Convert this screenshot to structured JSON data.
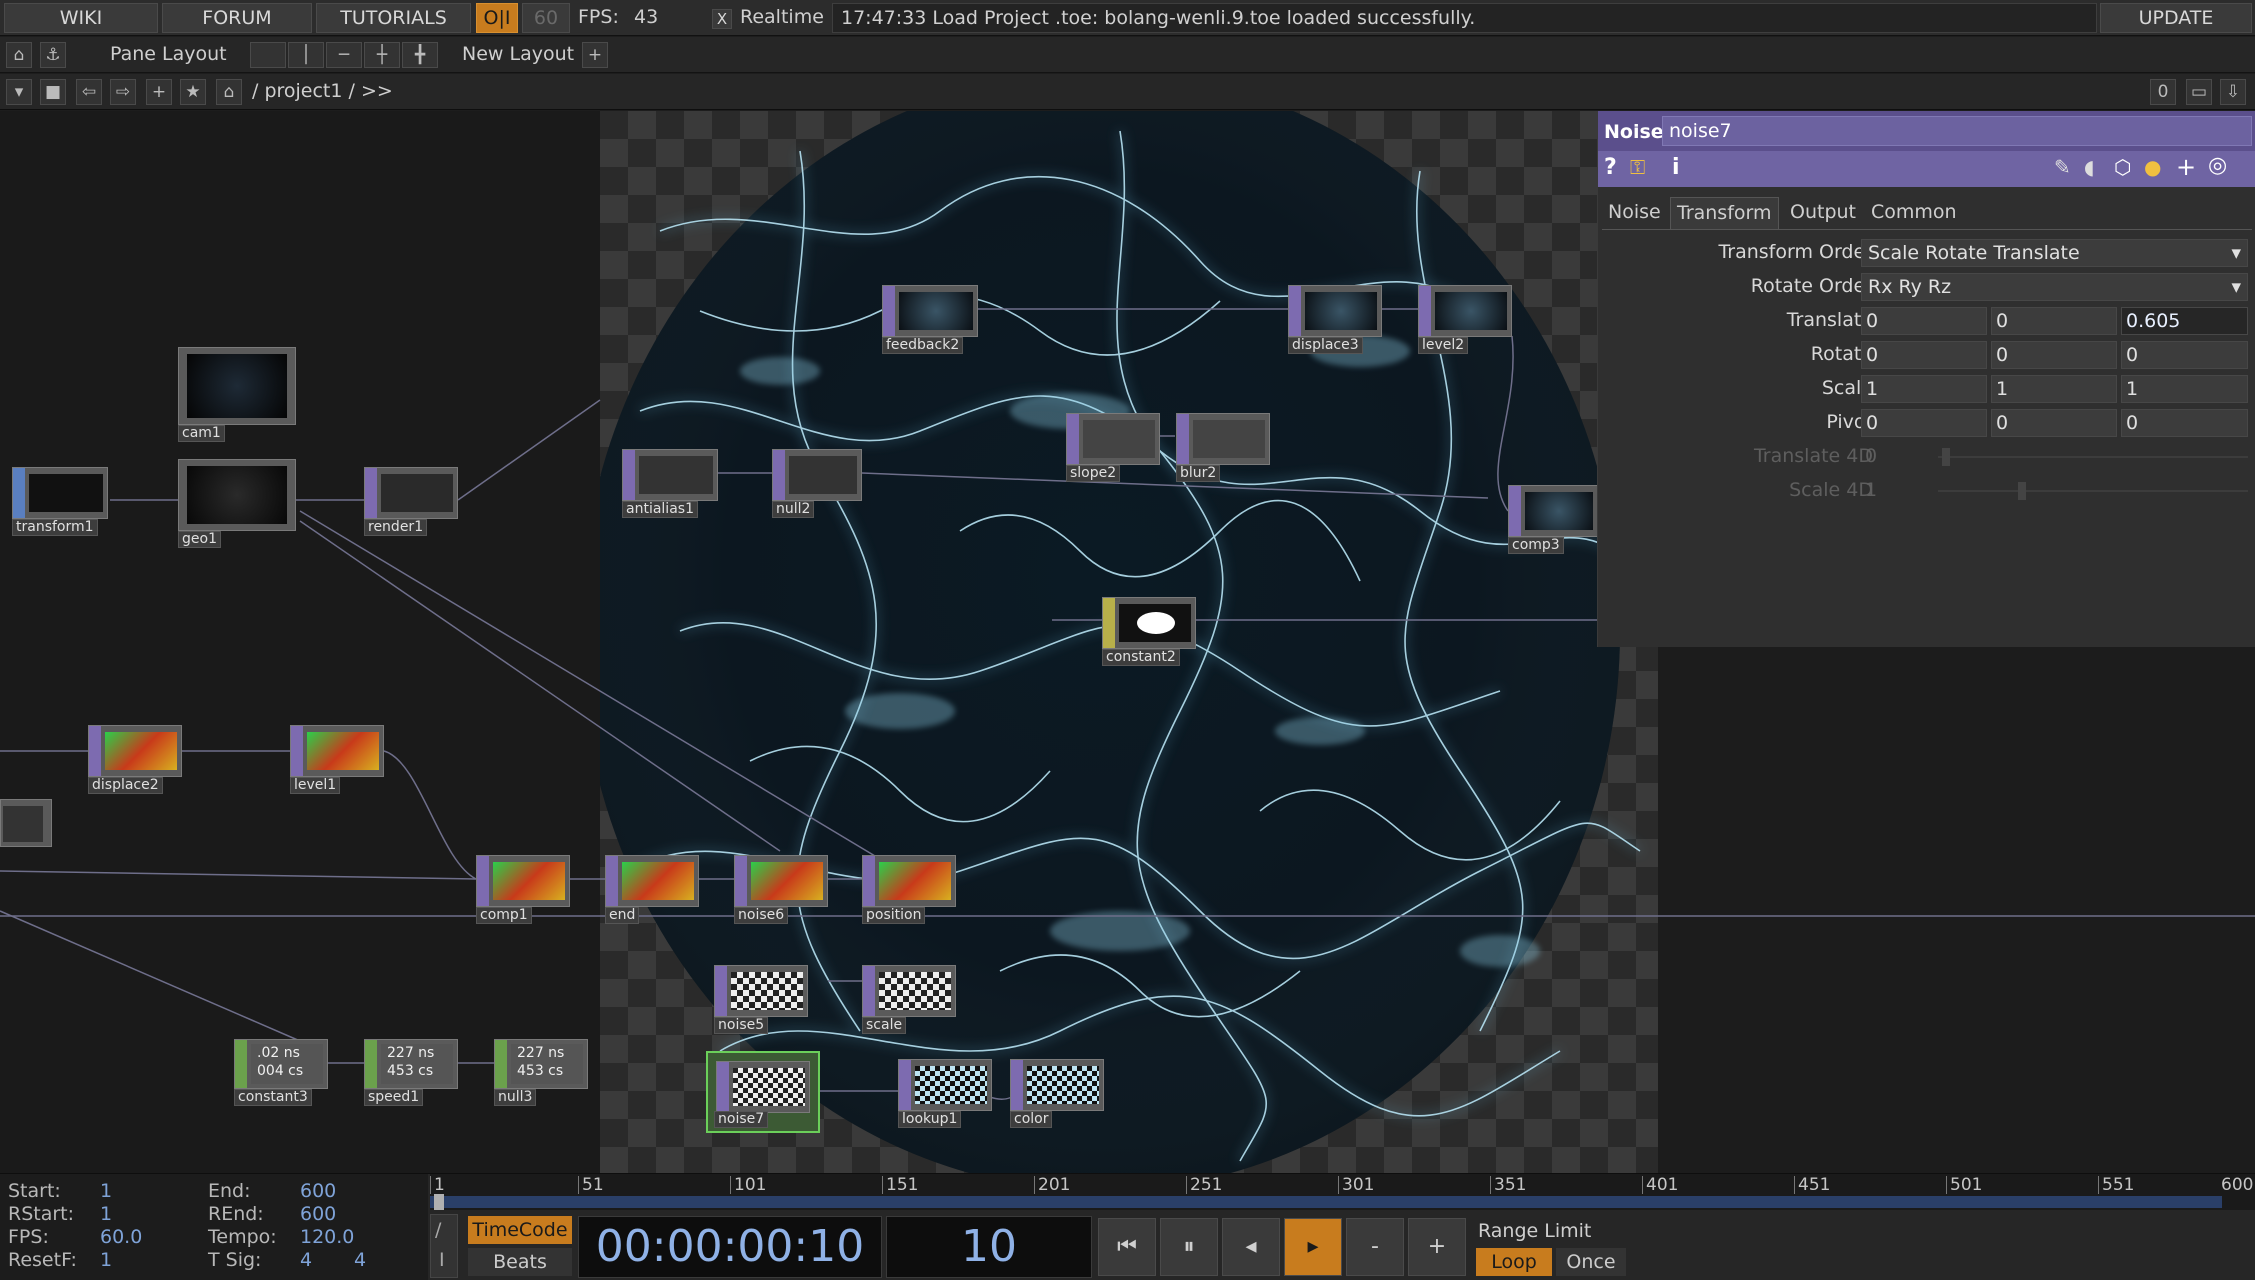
{
  "topbar": {
    "wiki": "WIKI",
    "forum": "FORUM",
    "tutorials": "TUTORIALS",
    "perf_toggle": "O|I",
    "fps_target": "60",
    "fps_label": "FPS:",
    "fps_value": "43",
    "realtime_check": "X",
    "realtime": "Realtime",
    "status": "17:47:33 Load Project .toe: bolang-wenli.9.toe loaded successfully.",
    "update": "UPDATE"
  },
  "layoutbar": {
    "pane_layout": "Pane Layout",
    "new_layout": "New Layout",
    "add": "+"
  },
  "pathbar": {
    "path": "/ project1 / >>",
    "counter": "0"
  },
  "nodes": [
    {
      "label": "cam1"
    },
    {
      "label": "transform1"
    },
    {
      "label": "geo1"
    },
    {
      "label": "render1"
    },
    {
      "label": "antialias1"
    },
    {
      "label": "null2"
    },
    {
      "label": "feedback2"
    },
    {
      "label": "displace3"
    },
    {
      "label": "level2"
    },
    {
      "label": "slope2"
    },
    {
      "label": "blur2"
    },
    {
      "label": "comp3"
    },
    {
      "label": "constant2"
    },
    {
      "label": "displace2"
    },
    {
      "label": "level1"
    },
    {
      "label": "comp1"
    },
    {
      "label": "end"
    },
    {
      "label": "noise6"
    },
    {
      "label": "position"
    },
    {
      "label": "noise5"
    },
    {
      "label": "scale"
    },
    {
      "label": "noise7"
    },
    {
      "label": "lookup1"
    },
    {
      "label": "color"
    },
    {
      "label": "constant3",
      "l1": ".02 ns",
      "l2": "004 cs"
    },
    {
      "label": "speed1",
      "l1": "227 ns",
      "l2": "453 cs"
    },
    {
      "label": "null3",
      "l1": "227 ns",
      "l2": "453 cs"
    }
  ],
  "params": {
    "op_type": "Noise",
    "op_name": "noise7",
    "tabs": [
      "Noise",
      "Transform",
      "Output",
      "Common"
    ],
    "active_tab": "Transform",
    "rows": [
      {
        "label": "Transform Order",
        "menu": "Scale Rotate Translate"
      },
      {
        "label": "Rotate Order",
        "menu": "Rx Ry Rz"
      },
      {
        "label": "Translate",
        "v": [
          "0",
          "0",
          "0.605"
        ]
      },
      {
        "label": "Rotate",
        "v": [
          "0",
          "0",
          "0"
        ]
      },
      {
        "label": "Scale",
        "v": [
          "1",
          "1",
          "1"
        ]
      },
      {
        "label": "Pivot",
        "v": [
          "0",
          "0",
          "0"
        ]
      },
      {
        "label": "Translate 4D",
        "v": [
          "0"
        ]
      },
      {
        "label": "Scale 4D",
        "v": [
          "1"
        ]
      }
    ]
  },
  "timeinfo": {
    "start_l": "Start:",
    "start": "1",
    "rstart_l": "RStart:",
    "rstart": "1",
    "fps_l": "FPS:",
    "fps": "60.0",
    "resetf_l": "ResetF:",
    "resetf": "1",
    "end_l": "End:",
    "end": "600",
    "rend_l": "REnd:",
    "rend": "600",
    "tempo_l": "Tempo:",
    "tempo": "120.0",
    "tsig_l": "T Sig:",
    "tsig1": "4",
    "tsig2": "4"
  },
  "timeline": {
    "ticks": [
      "1",
      "51",
      "101",
      "151",
      "201",
      "251",
      "301",
      "351",
      "401",
      "451",
      "501",
      "551",
      "600"
    ]
  },
  "transport": {
    "timecode_btn": "TimeCode",
    "beats_btn": "Beats",
    "slash": "/",
    "bar": "I",
    "timecode": "00:00:00:10",
    "frame": "10",
    "minus": "-",
    "plus": "+",
    "range_limit": "Range Limit",
    "loop": "Loop",
    "once": "Once"
  }
}
